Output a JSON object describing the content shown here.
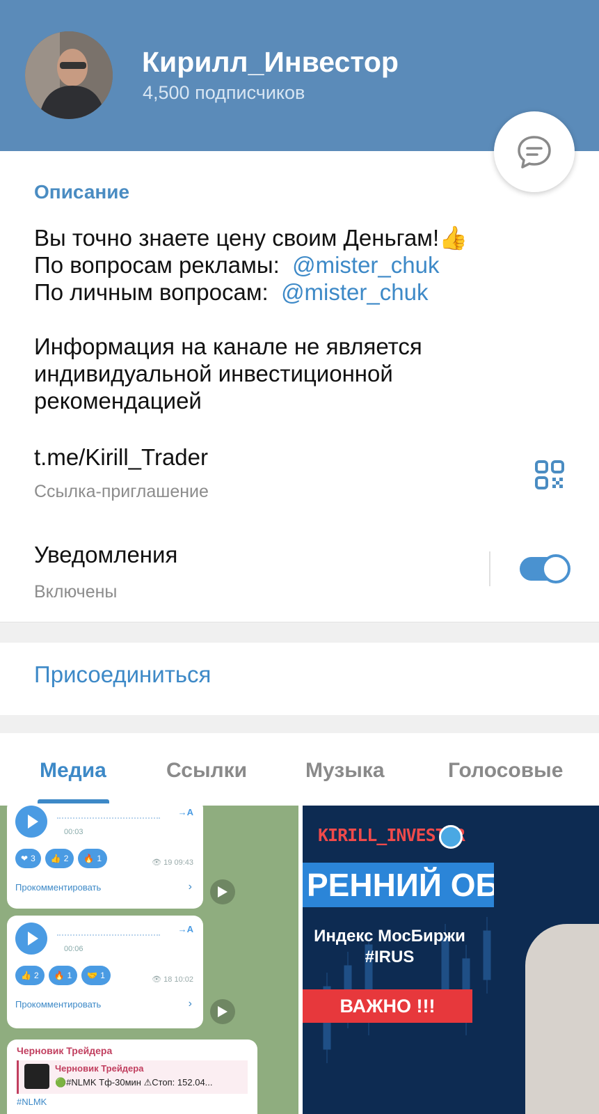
{
  "channel": {
    "title": "Кирилл_Инвестор",
    "subscribers": "4,500 подписчиков"
  },
  "icons": {
    "chat": "chat-bubble-icon",
    "qr": "qr-code-icon"
  },
  "info": {
    "description_label": "Описание",
    "description_lines": {
      "l1": "Вы точно знаете цену своим Деньгам!👍",
      "l2_prefix": "По вопросам рекламы:  ",
      "l2_link": "@mister_chuk",
      "l3_prefix": "По личным вопросам:  ",
      "l3_link": "@mister_chuk",
      "l4": "Информация на канале не является",
      "l5": "индивидуальной инвестиционной",
      "l6": "рекомендацией"
    },
    "invite_link": "t.me/Kirill_Trader",
    "invite_label": "Ссылка-приглашение",
    "notifications_label": "Уведомления",
    "notifications_state": "Включены",
    "notifications_on": true
  },
  "join_label": "Присоединиться",
  "tabs": {
    "media": "Медиа",
    "links": "Ссылки",
    "music": "Музыка",
    "voice": "Голосовые",
    "active": "media"
  },
  "media_left": {
    "msg1": {
      "duration": "00:03",
      "translate": "→A",
      "reactions": [
        {
          "emoji": "❤",
          "count": "3"
        },
        {
          "emoji": "👍",
          "count": "2"
        },
        {
          "emoji": "🔥",
          "count": "1"
        }
      ],
      "views": "👁 19  09:43",
      "comment": "Прокомментировать"
    },
    "msg2": {
      "duration": "00:06",
      "translate": "→A",
      "reactions": [
        {
          "emoji": "👍",
          "count": "2"
        },
        {
          "emoji": "🔥",
          "count": "1"
        },
        {
          "emoji": "🤝",
          "count": "1"
        }
      ],
      "views": "👁 18  10:02",
      "comment": "Прокомментировать"
    },
    "draft": {
      "title": "Черновик Трейдера",
      "quote_title": "Черновик Трейдера",
      "quote_text": "🟢#NLMK Тф-30мин ⚠Стоп: 152.04...",
      "tag": "#NLMK"
    }
  },
  "media_right": {
    "badge": "KIRILL_INVESTOR",
    "title": "РЕННИЙ ОБЗОР",
    "subtitle1": "Индекс МосБиржи",
    "subtitle2": "#IRUS",
    "warning": "ВАЖНО !!!"
  }
}
